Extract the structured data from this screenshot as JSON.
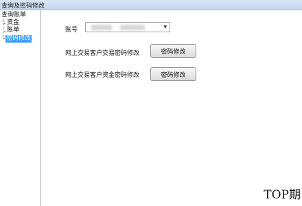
{
  "window": {
    "title": "查询及密码修改"
  },
  "tree": {
    "root": "查询账单",
    "children": [
      "资金",
      "账单",
      "密码修改"
    ],
    "selected": "密码修改"
  },
  "form": {
    "account_label": "账号",
    "password_rows": [
      {
        "label": "网上交易客户交易密码修改",
        "button": "密码修改"
      },
      {
        "label": "网上交易客户资金密码修改",
        "button": "密码修改"
      }
    ]
  },
  "watermark": "TOP期",
  "icons": {
    "dropdown": "triangle-down"
  }
}
